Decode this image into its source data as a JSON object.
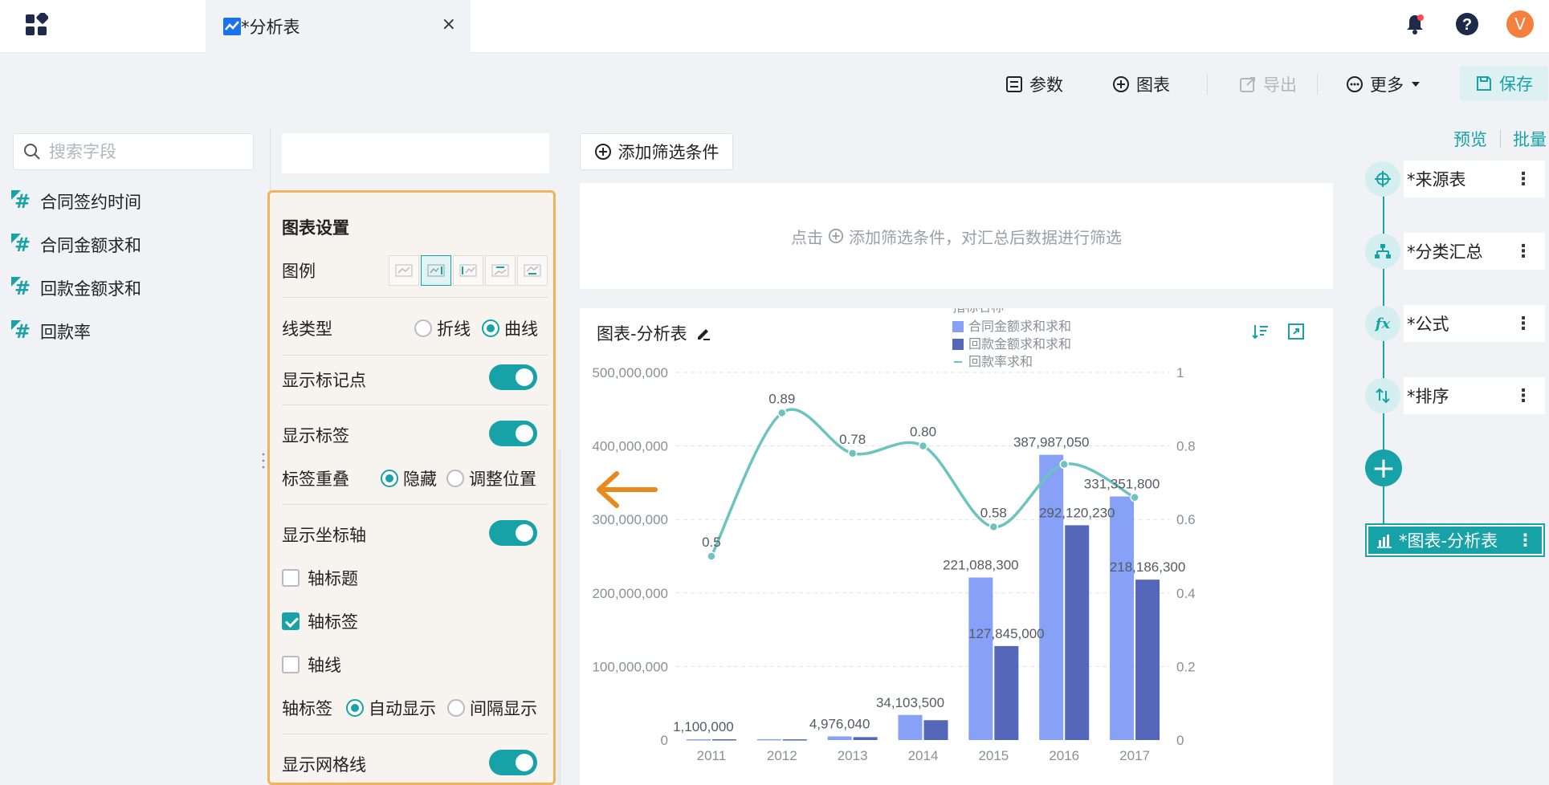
{
  "topbar": {
    "tab_title": "*分析表",
    "close": "×",
    "avatar_letter": "V"
  },
  "toolbar": {
    "params": "参数",
    "chart": "图表",
    "export": "导出",
    "more": "更多",
    "save": "保存"
  },
  "fields": {
    "search_placeholder": "搜索字段",
    "items": [
      "合同签约时间",
      "合同金额求和",
      "回款金额求和",
      "回款率"
    ]
  },
  "settings": {
    "section_title": "图表设置",
    "legend_label": "图例",
    "line_type_label": "线类型",
    "line_type_options": [
      "折线",
      "曲线"
    ],
    "line_type_selected": "曲线",
    "show_markers": "显示标记点",
    "show_labels": "显示标签",
    "label_overlap_label": "标签重叠",
    "label_overlap_options": [
      "隐藏",
      "调整位置"
    ],
    "label_overlap_selected": "隐藏",
    "show_axis": "显示坐标轴",
    "axis_title": "轴标题",
    "axis_title_checked": false,
    "axis_labels": "轴标签",
    "axis_labels_checked": true,
    "axis_line": "轴线",
    "axis_line_checked": false,
    "axis_label_mode_label": "轴标签",
    "axis_label_mode_options": [
      "自动显示",
      "间隔显示"
    ],
    "axis_label_mode_selected": "自动显示",
    "show_grid": "显示网格线",
    "toggles": {
      "markers": true,
      "labels": true,
      "axis": true,
      "grid": true
    }
  },
  "filter": {
    "add_button": "添加筛选条件",
    "hint_prefix": "点击",
    "hint_suffix": "添加筛选条件，对汇总后数据进行筛选"
  },
  "chart_panel": {
    "title": "图表-分析表"
  },
  "pipeline": {
    "preview": "预览",
    "batch": "批量",
    "nodes": [
      "*来源表",
      "*分类汇总",
      "*公式",
      "*排序"
    ],
    "chart_node": "*图表-分析表",
    "more": "⋮"
  },
  "colors": {
    "accent": "#17a2a8",
    "bar1": "#86a1f5",
    "bar2": "#5467b8",
    "line": "#6cc3bf",
    "highlight_border": "#f0b25c",
    "arrow": "#e8891b"
  },
  "chart_data": {
    "type": "bar",
    "categories": [
      "2011",
      "2012",
      "2013",
      "2014",
      "2015",
      "2016",
      "2017"
    ],
    "series": [
      {
        "name": "合同金额求和求和",
        "type": "bar",
        "axis": "left",
        "values": [
          1100000,
          1200000,
          4976040,
          34103500,
          221088300,
          387987050,
          331351800
        ]
      },
      {
        "name": "回款金额求和求和",
        "type": "bar",
        "axis": "left",
        "values": [
          1100000,
          1000000,
          4000000,
          27000000,
          127845000,
          292120230,
          218186300
        ]
      },
      {
        "name": "回款率求和",
        "type": "line",
        "smooth": true,
        "axis": "right",
        "values": [
          0.5,
          0.89,
          0.78,
          0.8,
          0.58,
          0.75,
          0.66
        ]
      }
    ],
    "data_labels": [
      {
        "text": "1,100,000",
        "category": "2011",
        "series": 0
      },
      {
        "text": "4,976,040",
        "category": "2013",
        "series": 0
      },
      {
        "text": "34,103,500",
        "category": "2014",
        "series": 0
      },
      {
        "text": "221,088,300",
        "category": "2015",
        "series": 0
      },
      {
        "text": "127,845,000",
        "category": "2015",
        "series": 1
      },
      {
        "text": "387,987,050",
        "category": "2016",
        "series": 0
      },
      {
        "text": "292,120,230",
        "category": "2016",
        "series": 1
      },
      {
        "text": "331,351,800",
        "category": "2017",
        "series": 0
      },
      {
        "text": "218,186,300",
        "category": "2017",
        "series": 1
      },
      {
        "text": "0.5",
        "category": "2011",
        "series": 2
      },
      {
        "text": "0.89",
        "category": "2012",
        "series": 2
      },
      {
        "text": "0.78",
        "category": "2013",
        "series": 2
      },
      {
        "text": "0.80",
        "category": "2014",
        "series": 2
      },
      {
        "text": "0.58",
        "category": "2015",
        "series": 2
      }
    ],
    "y_left_ticks": [
      "0",
      "100,000,000",
      "200,000,000",
      "300,000,000",
      "400,000,000",
      "500,000,000"
    ],
    "y_left_range": [
      0,
      500000000
    ],
    "y_right_ticks": [
      "0",
      "0.2",
      "0.4",
      "0.6",
      "0.8",
      "1"
    ],
    "y_right_range": [
      0,
      1
    ],
    "legend_title": "指标名称",
    "legend_placement": "right",
    "grid": true
  }
}
